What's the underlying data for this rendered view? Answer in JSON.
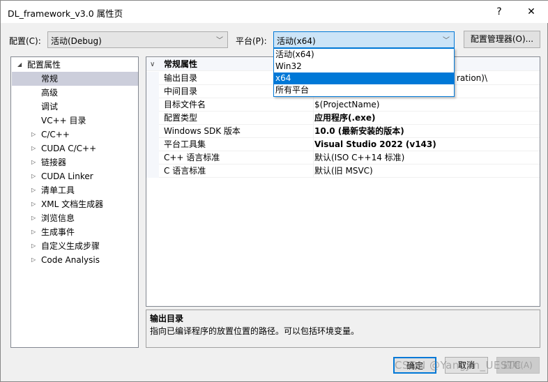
{
  "window": {
    "title": "DL_framework_v3.0 属性页",
    "help": "?",
    "close": "✕"
  },
  "config": {
    "label": "配置(C):",
    "value": "活动(Debug)"
  },
  "platform": {
    "label": "平台(P):",
    "value": "活动(x64)",
    "options": [
      "活动(x64)",
      "Win32",
      "x64",
      "所有平台"
    ],
    "selected": "x64"
  },
  "config_manager": "配置管理器(O)...",
  "tree": [
    {
      "label": "配置属性",
      "expand": "◢"
    },
    {
      "label": "常规",
      "selected": true
    },
    {
      "label": "高级"
    },
    {
      "label": "调试"
    },
    {
      "label": "VC++ 目录"
    },
    {
      "label": "C/C++",
      "expand": "▷"
    },
    {
      "label": "CUDA C/C++",
      "expand": "▷"
    },
    {
      "label": "链接器",
      "expand": "▷"
    },
    {
      "label": "CUDA Linker",
      "expand": "▷"
    },
    {
      "label": "清单工具",
      "expand": "▷"
    },
    {
      "label": "XML 文档生成器",
      "expand": "▷"
    },
    {
      "label": "浏览信息",
      "expand": "▷"
    },
    {
      "label": "生成事件",
      "expand": "▷"
    },
    {
      "label": "自定义生成步骤",
      "expand": "▷"
    },
    {
      "label": "Code Analysis",
      "expand": "▷"
    }
  ],
  "grid": {
    "category": "常规属性",
    "rows": [
      {
        "name": "输出目录",
        "value": "ration)\\"
      },
      {
        "name": "中间目录",
        "value": ""
      },
      {
        "name": "目标文件名",
        "value": "$(ProjectName)"
      },
      {
        "name": "配置类型",
        "value": "应用程序(.exe)",
        "bold": true
      },
      {
        "name": "Windows SDK 版本",
        "value": "10.0 (最新安装的版本)",
        "bold": true
      },
      {
        "name": "平台工具集",
        "value": "Visual Studio 2022 (v143)",
        "bold": true
      },
      {
        "name": "C++ 语言标准",
        "value": "默认(ISO C++14 标准)"
      },
      {
        "name": "C 语言标准",
        "value": "默认(旧 MSVC)"
      }
    ]
  },
  "description": {
    "title": "输出目录",
    "text": "指向已编译程序的放置位置的路径。可以包括环境变量。"
  },
  "buttons": {
    "ok": "确定",
    "cancel": "取消",
    "apply": "应用(A)"
  },
  "watermark": "CSDN @YangJin_UESTC"
}
